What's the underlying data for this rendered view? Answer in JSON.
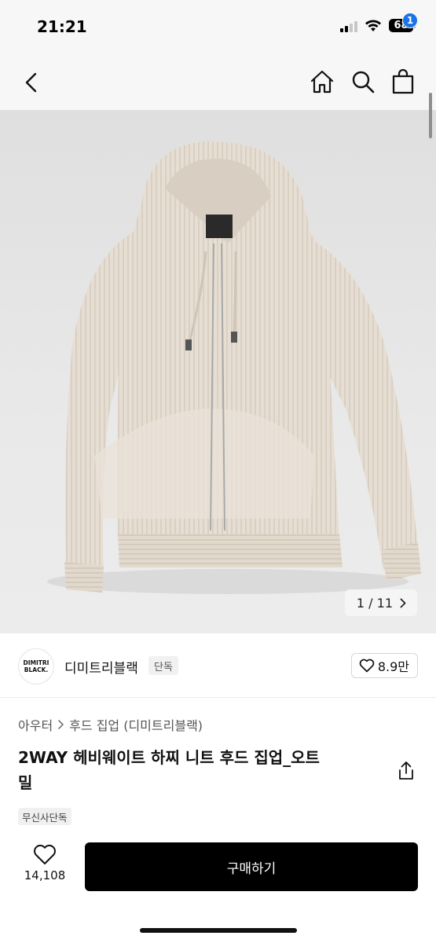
{
  "status_bar": {
    "time": "21:21",
    "battery": "68",
    "icons": [
      "cellular-signal-icon",
      "wifi-icon",
      "battery-icon"
    ]
  },
  "header": {
    "icons": [
      "back-arrow-icon",
      "home-icon",
      "search-icon",
      "shopping-bag-icon"
    ],
    "cart_badge": "1"
  },
  "gallery": {
    "counter": "1 / 11",
    "image_alt": "beige ribbed knit zip-up hoodie product photo"
  },
  "brand": {
    "logo_line1": "DIMITRI",
    "logo_line2": "BLACK.",
    "name": "디미트리블랙",
    "tag": "단독",
    "likes": "8.9만"
  },
  "product": {
    "breadcrumb": [
      "아우터",
      "후드 집업 (디미트리블랙)"
    ],
    "title_line1": "2WAY 헤비웨이트 하찌 니트 후드 집업_오트",
    "title_line2": "밀",
    "badge": "무신사단독"
  },
  "bottom_bar": {
    "wish_count": "14,108",
    "buy_label": "구매하기"
  },
  "colors": {
    "accent_badge": "#1a73e8",
    "buy_button": "#000000",
    "hoodie": "#e4dcd1"
  }
}
